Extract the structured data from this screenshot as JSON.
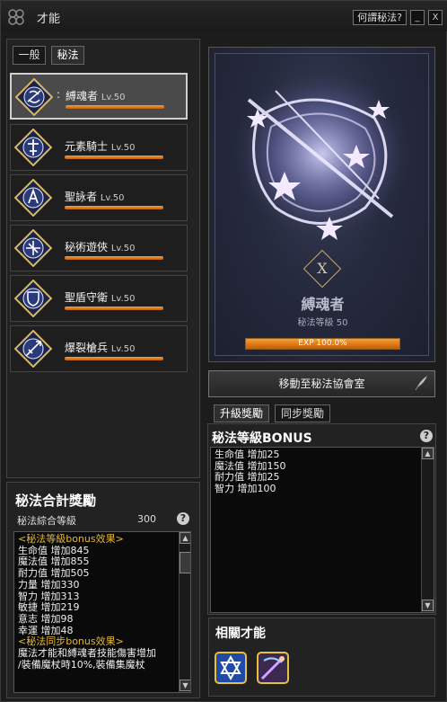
{
  "window": {
    "title": "才能",
    "help_button": "何謂秘法?",
    "minimize": "_",
    "close": "X"
  },
  "tabs": [
    "一般",
    "秘法"
  ],
  "classes": [
    {
      "name": "縛魂者",
      "level": "Lv.50",
      "selected": true
    },
    {
      "name": "元素騎士",
      "level": "Lv.50"
    },
    {
      "name": "聖詠者",
      "level": "Lv.50"
    },
    {
      "name": "秘術遊俠",
      "level": "Lv.50"
    },
    {
      "name": "聖盾守衛",
      "level": "Lv.50"
    },
    {
      "name": "爆裂槍兵",
      "level": "Lv.50"
    }
  ],
  "selected_colon": ":",
  "summary": {
    "title": "秘法合計獎勵",
    "level_label": "秘法綜合等級",
    "level_value": "300",
    "lines": [
      {
        "text": "<秘法等級bonus效果>",
        "header": true
      },
      {
        "text": "生命值 增加845"
      },
      {
        "text": "魔法值 增加855"
      },
      {
        "text": "耐力值 增加505"
      },
      {
        "text": "力量 增加330"
      },
      {
        "text": "智力 增加313"
      },
      {
        "text": "敏捷 增加219"
      },
      {
        "text": "意志 增加98"
      },
      {
        "text": "幸運 增加48"
      },
      {
        "text": ""
      },
      {
        "text": "<秘法同步bonus效果>",
        "header": true
      },
      {
        "text": "魔法才能和縛魂者技能傷害增加"
      },
      {
        "text": "/裝備魔杖時10%,裝備集魔杖"
      }
    ]
  },
  "card": {
    "badge": "X",
    "class_name": "縛魂者",
    "level_text": "秘法等級 50",
    "exp_text": "EXP 100.0%",
    "exp_progress": 1.0
  },
  "move_button": "移動至秘法協會室",
  "bonus_tabs": [
    "升級獎勵",
    "同步獎勵"
  ],
  "bonus": {
    "title": "秘法等級BONUS",
    "lines": [
      "生命值 增加25",
      "魔法值 增加150",
      "耐力值 增加25",
      "智力 增加100"
    ]
  },
  "related": {
    "title": "相關才能"
  },
  "colors": {
    "accent_orange": "#e8801c",
    "exp_orange": "#f5a030",
    "header_gold": "#e6b830",
    "card_bg": "#262a3e",
    "emblem_blue": "#2a3a7a"
  }
}
